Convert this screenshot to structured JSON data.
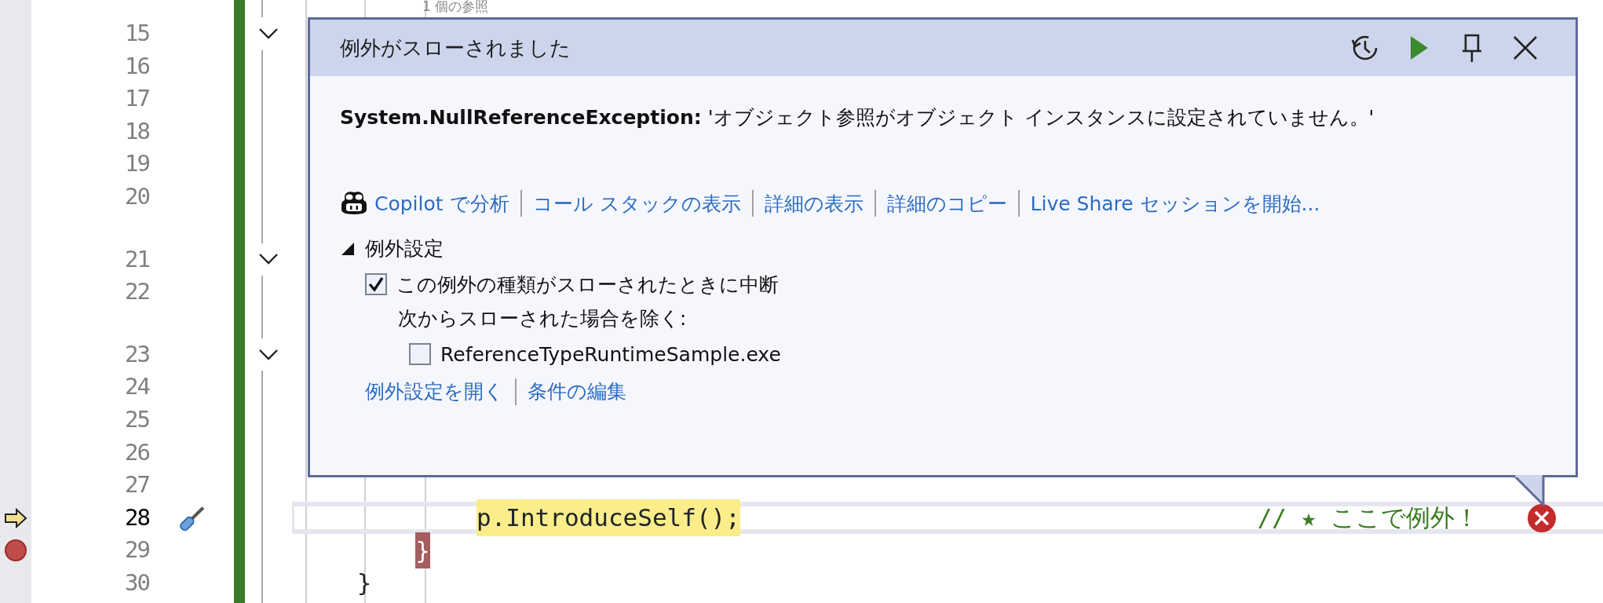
{
  "editor": {
    "lines": [
      {
        "kind": "codelens",
        "text": "1 個の参照"
      },
      {
        "kind": "line",
        "number": "15",
        "fold": true,
        "current": false,
        "breakpoint": false
      },
      {
        "kind": "line",
        "number": "16",
        "fold": false,
        "current": false,
        "breakpoint": false
      },
      {
        "kind": "line",
        "number": "17",
        "fold": false,
        "current": false,
        "breakpoint": false
      },
      {
        "kind": "line",
        "number": "18",
        "fold": false,
        "current": false,
        "breakpoint": false
      },
      {
        "kind": "line",
        "number": "19",
        "fold": false,
        "current": false,
        "breakpoint": false
      },
      {
        "kind": "line",
        "number": "20",
        "fold": false,
        "current": false,
        "breakpoint": false
      },
      {
        "kind": "codelens"
      },
      {
        "kind": "line",
        "number": "21",
        "fold": true,
        "current": false,
        "breakpoint": false
      },
      {
        "kind": "line",
        "number": "22",
        "fold": false,
        "current": false,
        "breakpoint": false
      },
      {
        "kind": "codelens"
      },
      {
        "kind": "line",
        "number": "23",
        "fold": true,
        "current": false,
        "breakpoint": false
      },
      {
        "kind": "line",
        "number": "24",
        "fold": false,
        "current": false,
        "breakpoint": false
      },
      {
        "kind": "line",
        "number": "25",
        "fold": false,
        "current": false,
        "breakpoint": false
      },
      {
        "kind": "line",
        "number": "26",
        "fold": false,
        "current": false,
        "breakpoint": false
      },
      {
        "kind": "line",
        "number": "27",
        "fold": false,
        "current": false,
        "breakpoint": false
      },
      {
        "kind": "line",
        "number": "28",
        "fold": false,
        "current": true,
        "breakpoint": false,
        "code": "            p.IntroduceSelf();",
        "comment": "// ★ ここで例外！",
        "error": true
      },
      {
        "kind": "line",
        "number": "29",
        "fold": false,
        "current": false,
        "breakpoint": true,
        "code": "        }"
      },
      {
        "kind": "line",
        "number": "30",
        "fold": false,
        "current": false,
        "breakpoint": false,
        "code": "    }"
      }
    ]
  },
  "exception_popup": {
    "title": "例外がスローされました",
    "message": "**System.NullReferenceException:** 'オブジェクト参照がオブジェクト インスタンスに設定されていません。'",
    "links": [
      {
        "kind": "copilot",
        "text": "Copilot で分析"
      },
      {
        "kind": "plain",
        "text": "コール スタックの表示"
      },
      {
        "kind": "plain",
        "text": "詳細の表示"
      },
      {
        "kind": "plain",
        "text": "詳細のコピー"
      },
      {
        "kind": "plain",
        "text": "Live Share セッションを開始..."
      }
    ],
    "settings": {
      "title": "例外設定",
      "expanded": true,
      "break_option": {
        "label": "この例外の種類がスローされたときに中断",
        "checked": true
      },
      "exclude_label": "次からスローされた場合を除く:",
      "exclude_items": [
        {
          "label": "ReferenceTypeRuntimeSample.exe",
          "checked": false
        }
      ]
    },
    "footer_links": [
      "例外設定を開く",
      "条件の編集"
    ]
  }
}
